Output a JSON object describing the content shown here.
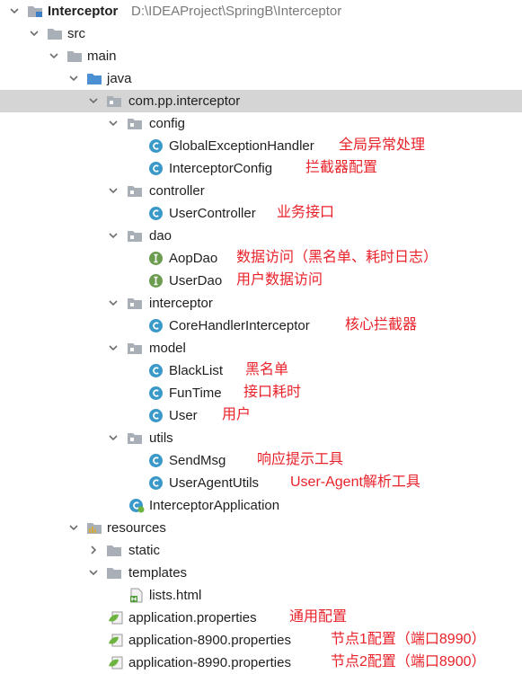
{
  "tree": {
    "project": {
      "name": "Interceptor",
      "path": "D:\\IDEAProject\\SpringB\\Interceptor"
    },
    "rows": [
      {
        "label": "src"
      },
      {
        "label": "main"
      },
      {
        "label": "java"
      },
      {
        "label": "com.pp.interceptor"
      },
      {
        "label": "config"
      },
      {
        "label": "GlobalExceptionHandler",
        "note": "全局异常处理"
      },
      {
        "label": "InterceptorConfig",
        "note": "拦截器配置"
      },
      {
        "label": "controller"
      },
      {
        "label": "UserController",
        "note": "业务接口"
      },
      {
        "label": "dao"
      },
      {
        "label": "AopDao",
        "note": "数据访问（黑名单、耗时日志）"
      },
      {
        "label": "UserDao",
        "note": "用户数据访问"
      },
      {
        "label": "interceptor"
      },
      {
        "label": "CoreHandlerInterceptor",
        "note": "核心拦截器"
      },
      {
        "label": "model"
      },
      {
        "label": "BlackList",
        "note": "黑名单"
      },
      {
        "label": "FunTime",
        "note": "接口耗时"
      },
      {
        "label": "User",
        "note": "用户"
      },
      {
        "label": "utils"
      },
      {
        "label": "SendMsg",
        "note": "响应提示工具"
      },
      {
        "label": "UserAgentUtils",
        "note": "User-Agent解析工具"
      },
      {
        "label": "InterceptorApplication"
      },
      {
        "label": "resources"
      },
      {
        "label": "static"
      },
      {
        "label": "templates"
      },
      {
        "label": "lists.html"
      },
      {
        "label": "application.properties",
        "note": "通用配置"
      },
      {
        "label": "application-8900.properties",
        "note": "节点1配置（端口8990）"
      },
      {
        "label": "application-8990.properties",
        "note": "节点2配置（端口8900）"
      }
    ]
  },
  "colors": {
    "selected_row": "#d5d5d5",
    "annotation": "#e8222a",
    "folder": "#a9afb6",
    "class_icon": "#3b99c9",
    "interface_icon": "#6c9c4f"
  }
}
